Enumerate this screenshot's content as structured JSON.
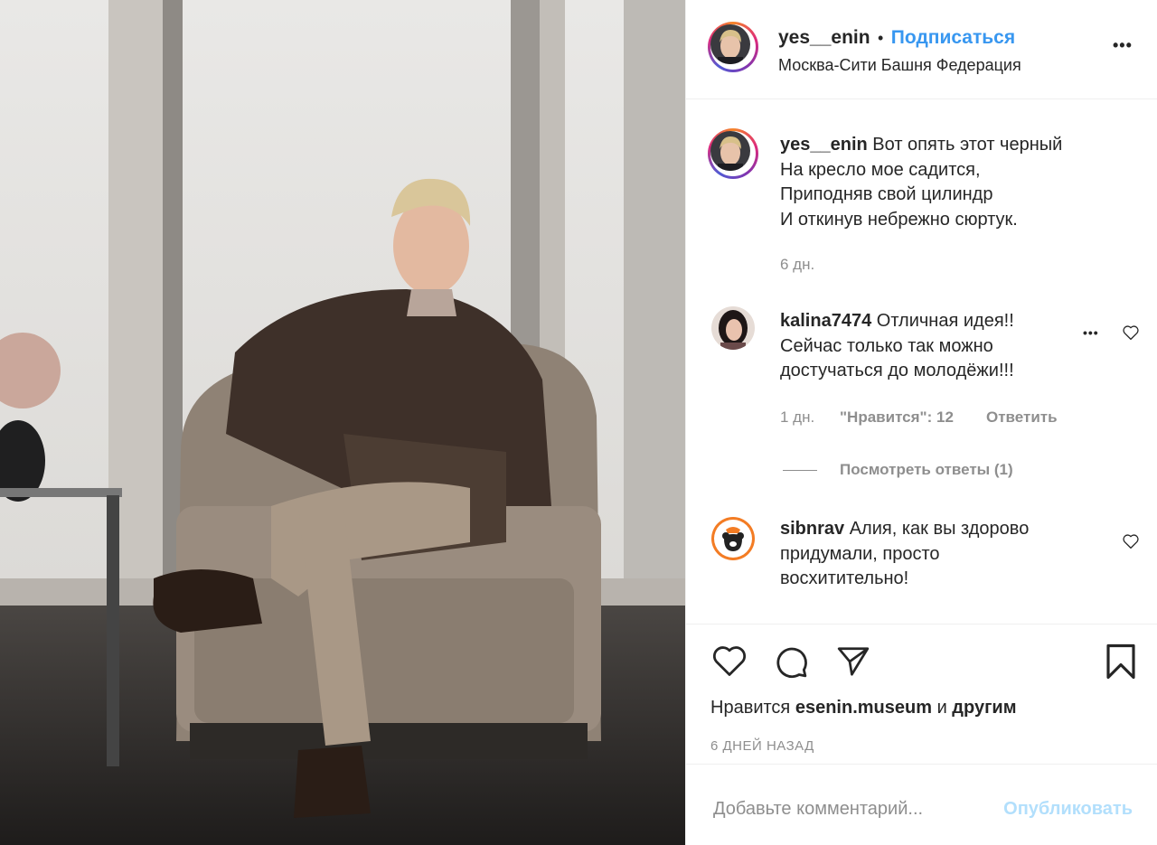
{
  "post": {
    "username": "yes__enin",
    "separator": "•",
    "follow_label": "Подписаться",
    "location": "Москва-Сити Башня Федерация"
  },
  "caption": {
    "username": "yes__enin",
    "text": "Вот опять этот черный\nНа кресло мое садится,\nПриподняв свой цилиндр\nИ откинув небрежно сюртук.",
    "time": "6 дн."
  },
  "comments": [
    {
      "username": "kalina7474",
      "text": "Отличная идея!!\nСейчас только так можно\nдостучаться до молодёжи!!!",
      "time": "1 дн.",
      "likes": "\"Нравится\": 12",
      "reply_label": "Ответить",
      "view_replies": "Посмотреть ответы (1)",
      "more": "•••"
    },
    {
      "username": "sibnrav",
      "text": "Алия, как вы здорово\nпридумали, просто\nвосхитительно!"
    }
  ],
  "likes": {
    "prefix": "Нравится",
    "user": "esenin.museum",
    "middle": "и",
    "rest": "другим"
  },
  "posted_ago": "6 ДНЕЙ НАЗАД",
  "add_comment": {
    "placeholder": "Добавьте комментарий...",
    "publish_label": "Опубликовать"
  },
  "icons": [
    "heart-icon",
    "comment-icon",
    "share-icon",
    "bookmark-icon",
    "more-icon"
  ],
  "colors": {
    "follow": "#3897f0",
    "publish_disabled": "#b2dffc",
    "muted": "#8e8e8e",
    "text": "#262626"
  }
}
